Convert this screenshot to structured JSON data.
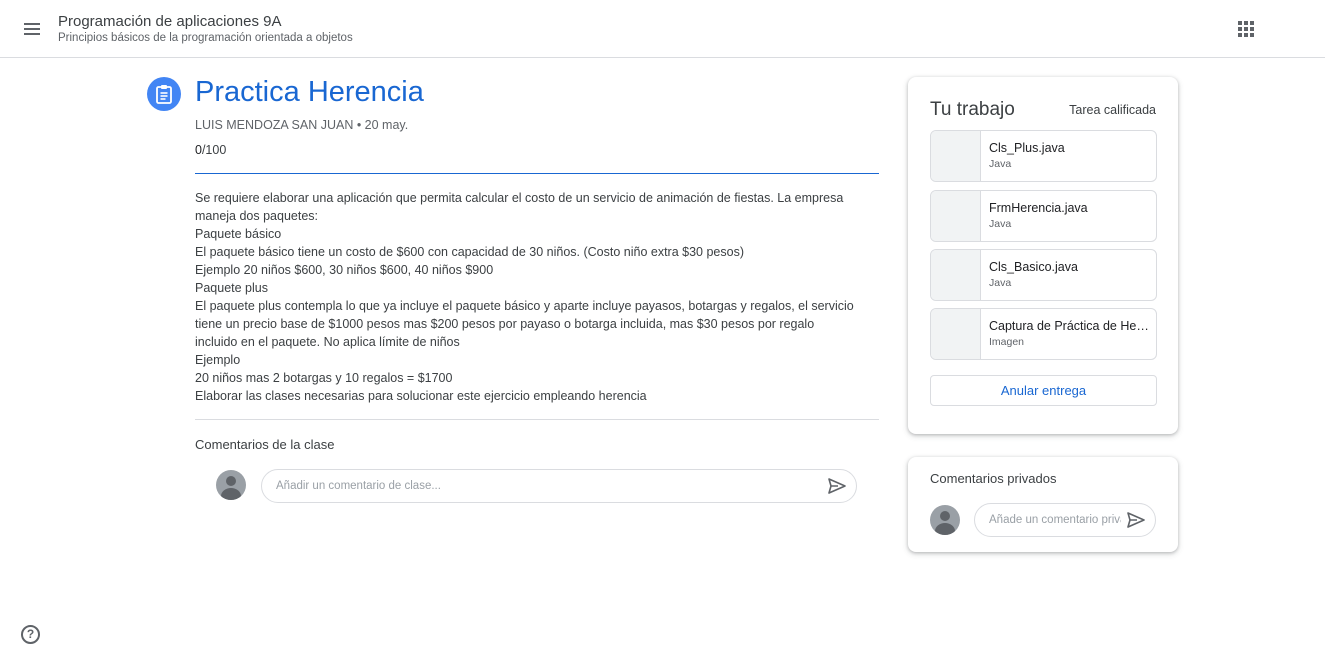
{
  "header": {
    "course_title": "Programación de aplicaciones 9A",
    "course_subtitle": "Principios básicos de la programación orientada a objetos",
    "menu_icon": "hamburger-menu-icon",
    "apps_icon": "apps-grid-icon"
  },
  "assignment": {
    "icon": "assignment-clipboard-icon",
    "title": "Practica Herencia",
    "meta": "LUIS MENDOZA SAN JUAN • 20 may.",
    "points_earned": "0",
    "points_total": "/100",
    "description_lines": [
      "Se requiere elaborar una aplicación que permita calcular el costo de un servicio de animación de fiestas. La empresa",
      "maneja dos paquetes:",
      "Paquete básico",
      "El paquete básico tiene un costo de $600 con capacidad de 30 niños. (Costo niño extra $30 pesos)",
      "Ejemplo 20 niños $600, 30 niños $600, 40 niños $900",
      "Paquete plus",
      "El paquete plus contempla lo que ya incluye el paquete básico y aparte incluye payasos, botargas y regalos,  el servicio",
      "tiene un precio base de $1000 pesos mas $200 pesos por payaso o botarga incluida, mas $30 pesos por regalo",
      "incluido en el paquete. No aplica límite de niños",
      "Ejemplo",
      "20 niños mas 2 botargas y 10 regalos = $1700",
      "Elaborar las clases necesarias para solucionar este ejercicio empleando herencia"
    ]
  },
  "class_comments": {
    "title": "Comentarios de la clase",
    "placeholder": "Añadir un comentario de clase..."
  },
  "your_work": {
    "title": "Tu trabajo",
    "status": "Tarea calificada",
    "attachments": [
      {
        "name": "Cls_Plus.java",
        "type": "Java"
      },
      {
        "name": "FrmHerencia.java",
        "type": "Java"
      },
      {
        "name": "Cls_Basico.java",
        "type": "Java"
      },
      {
        "name": "Captura de Práctica de Herencia",
        "type": "Imagen"
      }
    ],
    "unsubmit_label": "Anular entrega"
  },
  "private_comments": {
    "title": "Comentarios privados",
    "placeholder": "Añade un comentario privado..."
  },
  "colors": {
    "accent": "#1967d2",
    "icon_circle": "#4285f4"
  }
}
